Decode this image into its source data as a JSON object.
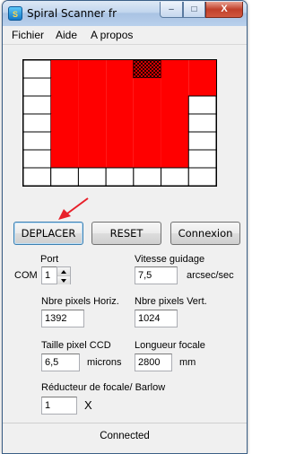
{
  "window": {
    "title": "Spiral Scanner fr",
    "icon": "app-icon",
    "controls": {
      "minimize": "–",
      "maximize": "□",
      "close": "X"
    }
  },
  "menu": {
    "items": [
      "Fichier",
      "Aide",
      "A propos"
    ]
  },
  "grid": {
    "cols": 7,
    "rows": 7,
    "colors": {
      "empty": "#ffffff",
      "filled": "#ff0000",
      "hatched": "#ff0000",
      "lines": "#000000"
    },
    "filled_rows": [
      [
        1,
        2,
        3,
        4,
        5,
        6
      ],
      [
        1,
        2,
        3,
        4,
        5,
        6
      ],
      [
        1,
        2,
        3,
        4,
        5
      ],
      [
        1,
        2,
        3,
        4,
        5
      ],
      [
        1,
        2,
        3,
        4,
        5
      ],
      [
        1,
        2,
        3,
        4,
        5
      ],
      []
    ],
    "hatched_cell": {
      "row": 0,
      "col": 4
    }
  },
  "buttons": {
    "deplacer": "DEPLACER",
    "reset": "RESET",
    "connexion": "Connexion"
  },
  "annotation": {
    "arrow_color": "#e8202a"
  },
  "form": {
    "com_label": "COM",
    "port": {
      "label": "Port",
      "value": "1"
    },
    "vitesse": {
      "label": "Vitesse guidage",
      "value": "7,5",
      "unit": "arcsec/sec"
    },
    "pixels_h": {
      "label": "Nbre pixels Horiz.",
      "value": "1392"
    },
    "pixels_v": {
      "label": "Nbre pixels Vert.",
      "value": "1024"
    },
    "pixel_size": {
      "label": "Taille pixel CCD",
      "value": "6,5",
      "unit": "microns"
    },
    "focal": {
      "label": "Longueur focale",
      "value": "2800",
      "unit": "mm"
    },
    "reducer": {
      "label": "Réducteur de focale/ Barlow",
      "value": "1",
      "unit": "X"
    }
  },
  "status": {
    "text": "Connected"
  }
}
